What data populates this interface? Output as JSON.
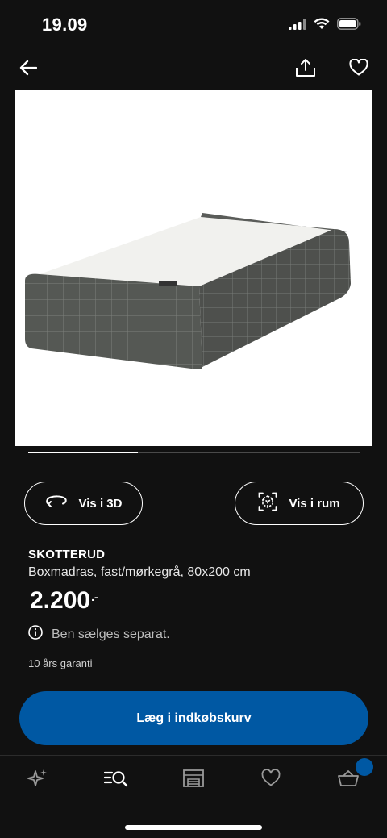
{
  "status_bar": {
    "time": "19.09",
    "icons": [
      "signal-icon",
      "wifi-icon",
      "battery-icon"
    ]
  },
  "top_nav": {
    "icons": [
      "back-arrow-icon",
      "share-icon",
      "heart-icon"
    ]
  },
  "product": {
    "name": "SKOTTERUD",
    "description": "Boxmadras, fast/mørkegrå, 80x200 cm",
    "price": "2.200",
    "price_suffix": ".-",
    "info_text": "Ben sælges separat.",
    "guarantee": "10 års garanti",
    "color": "#4e504d"
  },
  "carousel": {
    "progress": 0.33
  },
  "actions": {
    "view_3d_label": "Vis i 3D",
    "view_room_label": "Vis i rum",
    "add_to_cart_label": "Læg i indkøbskurv"
  },
  "tab_bar": {
    "items": [
      "inspiration-icon",
      "search-icon",
      "store-icon",
      "favorites-icon",
      "cart-icon"
    ],
    "cart_badge": true
  },
  "colors": {
    "background": "#111111",
    "primary_blue": "#0058a3",
    "text": "#ffffff",
    "muted_text": "#bdbdbd"
  }
}
